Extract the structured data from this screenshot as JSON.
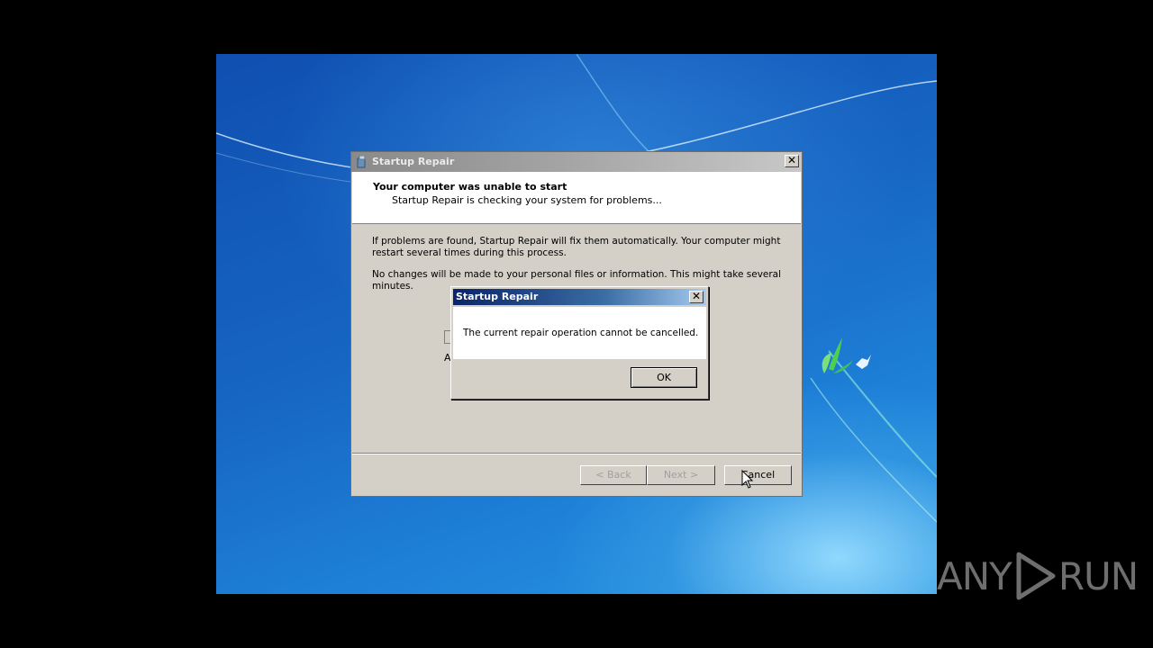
{
  "main_window": {
    "title": "Startup Repair",
    "header_title": "Your computer was unable to start",
    "header_subtitle": "Startup Repair is checking your system for problems...",
    "paragraph_1": "If problems are found, Startup Repair will fix them automatically. Your computer might restart several times during this process.",
    "paragraph_2": "No changes will be made to your personal files or information. This might take several minutes.",
    "partial_text": "A",
    "buttons": {
      "back": "< Back",
      "next": "Next >",
      "cancel": "Cancel"
    }
  },
  "dialog": {
    "title": "Startup Repair",
    "message": "The current repair operation cannot be cancelled.",
    "ok_label": "OK"
  },
  "watermark": {
    "left": "ANY",
    "right": "RUN"
  },
  "colors": {
    "dialog_title": "#0a246a",
    "window_face": "#d4d0c8",
    "desktop": "#1766c4"
  }
}
